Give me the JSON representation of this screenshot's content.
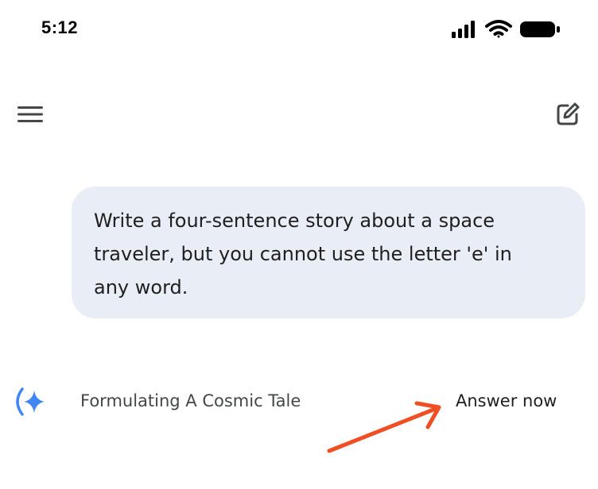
{
  "status_bar": {
    "time": "5:12",
    "icons": [
      "cellular-signal-icon",
      "wifi-icon",
      "battery-icon"
    ]
  },
  "app_bar": {
    "menu_icon": "hamburger-menu-icon",
    "new_chat_icon": "edit-square-icon"
  },
  "conversation": {
    "user_prompt": "Write a four-sentence story about a space traveler, but you cannot use the letter 'e' in any word."
  },
  "response": {
    "spark_icon": "gemini-spark-icon",
    "thinking_title": "Formulating A Cosmic Tale",
    "answer_now_label": "Answer now"
  },
  "annotation": {
    "arrow_icon": "red-arrow-icon",
    "arrow_color": "#f04e23"
  },
  "colors": {
    "bubble_bg": "#e9eef6",
    "spark_blue": "#4285f4",
    "text_primary": "#1f1f1f",
    "text_secondary": "#444746"
  }
}
